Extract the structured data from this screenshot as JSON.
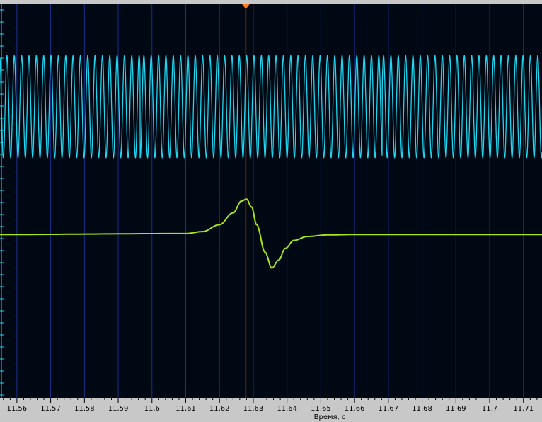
{
  "chart_data": {
    "type": "line",
    "xlabel": "Время, с",
    "ylabel": "",
    "xlim": [
      11.555,
      11.7155
    ],
    "ylim": [
      -1.0,
      1.0
    ],
    "x_ticks": [
      11.56,
      11.57,
      11.58,
      11.59,
      11.6,
      11.61,
      11.62,
      11.63,
      11.64,
      11.65,
      11.66,
      11.67,
      11.68,
      11.69,
      11.7,
      11.71
    ],
    "x_tick_labels": [
      "11,56",
      "11,57",
      "11,58",
      "11,59",
      "11,6",
      "11,61",
      "11,62",
      "11,63",
      "11,64",
      "11,65",
      "11,66",
      "11,67",
      "11,68",
      "11,69",
      "11,7",
      "11,71"
    ],
    "grid": true,
    "cursor": {
      "x": 11.6278,
      "color": "#ff7a22"
    },
    "series": [
      {
        "color": "#1ed6f0",
        "kind": "oscillation",
        "frequency_hz": 460,
        "center": 0.48,
        "amplitude": 0.26,
        "phase_glitches": [
          11.5965,
          11.6682
        ]
      },
      {
        "color": "#a6e619",
        "kind": "pulse",
        "baseline": -0.17,
        "x": [
          11.555,
          11.61,
          11.615,
          11.62,
          11.624,
          11.6265,
          11.628,
          11.6295,
          11.631,
          11.6335,
          11.6355,
          11.6375,
          11.6395,
          11.642,
          11.646,
          11.652,
          11.66,
          11.7155
        ],
        "y": [
          -0.17,
          -0.165,
          -0.155,
          -0.12,
          -0.06,
          0.0,
          0.01,
          -0.03,
          -0.12,
          -0.26,
          -0.34,
          -0.3,
          -0.24,
          -0.2,
          -0.18,
          -0.172,
          -0.17,
          -0.17
        ]
      }
    ]
  }
}
